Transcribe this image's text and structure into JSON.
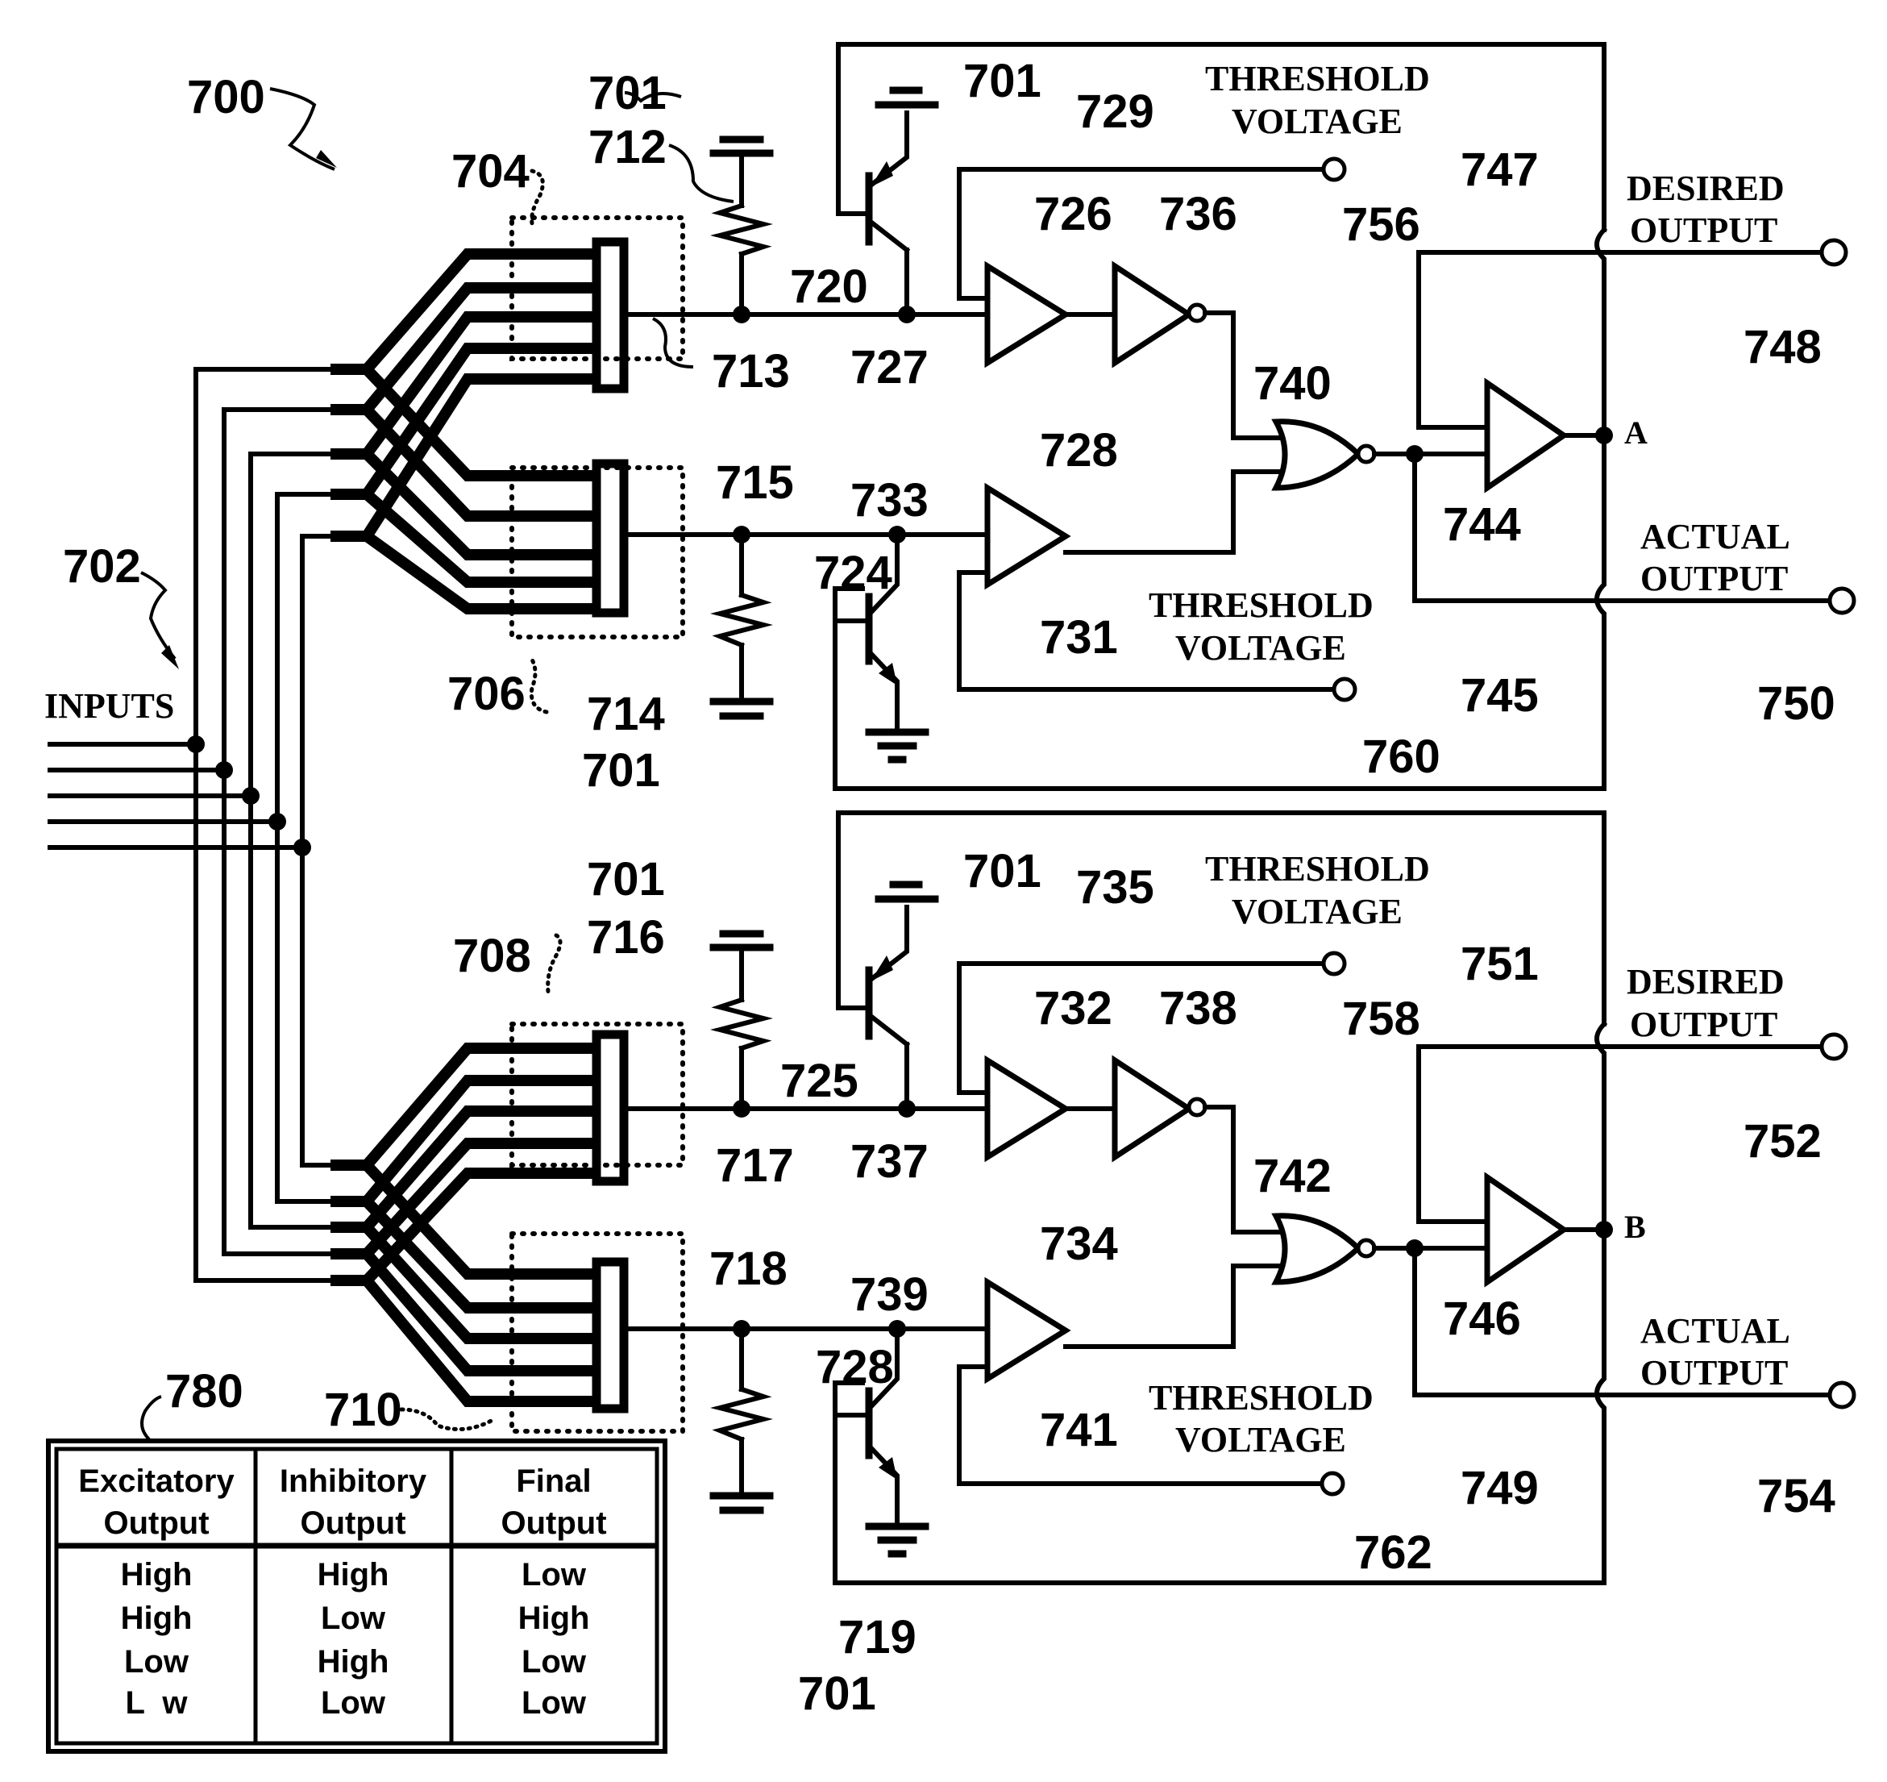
{
  "figure": {
    "reference": "700",
    "inputs_ref": "702",
    "inputs_label": "INPUTS",
    "ground_ref": "701"
  },
  "synapse_groups": [
    {
      "ref": "704",
      "output_ref": "713"
    },
    {
      "ref": "706",
      "output_ref": "715"
    },
    {
      "ref": "708",
      "output_ref": "717"
    },
    {
      "ref": "710",
      "output_ref": "718"
    }
  ],
  "resistors": [
    "712",
    "714",
    "716",
    "719"
  ],
  "transistors": [
    "720",
    "724",
    "725",
    "728"
  ],
  "neuron_a": {
    "node_label": "A",
    "excitatory_line": "727",
    "inhibitory_line": "733",
    "comparator_excitatory": "726",
    "inverter": "736",
    "comparator_inhibitory": "728",
    "threshold_line_top": "729",
    "threshold_line_bottom": "731",
    "threshold_terminal_top": "756",
    "threshold_terminal_bottom": "760",
    "nor_gate": "740",
    "output_buffer": "744",
    "desired_line": "747",
    "actual_line": "745",
    "desired_terminal": "748",
    "actual_terminal": "750",
    "threshold_label_1": "THRESHOLD",
    "threshold_label_2": "VOLTAGE",
    "desired_label_1": "DESIRED",
    "desired_label_2": "OUTPUT",
    "actual_label_1": "ACTUAL",
    "actual_label_2": "OUTPUT"
  },
  "neuron_b": {
    "node_label": "B",
    "excitatory_line": "737",
    "inhibitory_line": "739",
    "comparator_excitatory": "732",
    "inverter": "738",
    "comparator_inhibitory": "734",
    "threshold_line_top": "735",
    "threshold_line_bottom": "741",
    "threshold_terminal_top": "758",
    "threshold_terminal_bottom": "762",
    "nor_gate": "742",
    "output_buffer": "746",
    "desired_line": "751",
    "actual_line": "749",
    "desired_terminal": "752",
    "actual_terminal": "754",
    "threshold_label_1": "THRESHOLD",
    "threshold_label_2": "VOLTAGE",
    "desired_label_1": "DESIRED",
    "desired_label_2": "OUTPUT",
    "actual_label_1": "ACTUAL",
    "actual_label_2": "OUTPUT"
  },
  "truth_table": {
    "ref": "780",
    "headers": [
      [
        "Excitatory",
        "Output"
      ],
      [
        "Inhibitory",
        "Output"
      ],
      [
        "Final",
        "Output"
      ]
    ],
    "rows": [
      [
        "High",
        "High",
        "Low"
      ],
      [
        "High",
        "Low",
        "High"
      ],
      [
        "Low",
        "High",
        "Low"
      ],
      [
        "L  w",
        "Low",
        "Low"
      ]
    ]
  }
}
